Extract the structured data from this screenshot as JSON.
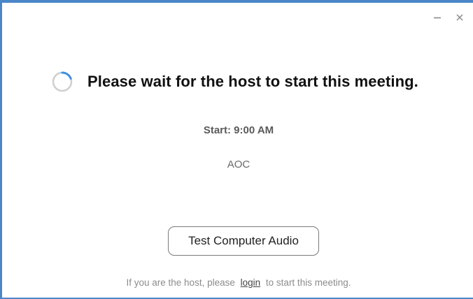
{
  "window": {
    "minimize_symbol": "–",
    "close_symbol": "×",
    "accent_color": "#4a86c8"
  },
  "main": {
    "headline": "Please wait for the host to start this meeting.",
    "start_time": "Start: 9:00 AM",
    "meeting_name": "AOC",
    "test_audio_label": "Test Computer Audio"
  },
  "footer": {
    "prefix": "If you are the host, please",
    "link_label": "login",
    "suffix": "to start this meeting."
  },
  "icons": {
    "spinner": "loading-spinner-icon",
    "minimize": "minimize-icon",
    "close": "close-icon"
  }
}
